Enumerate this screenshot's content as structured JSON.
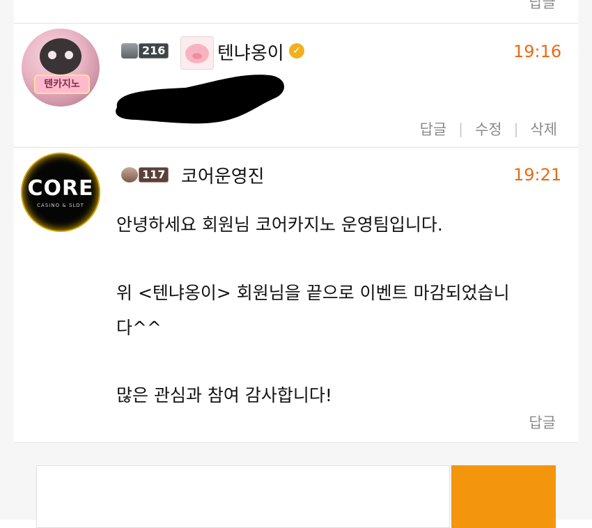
{
  "top": {
    "reply_label": "답글"
  },
  "comments": [
    {
      "level": "216",
      "nickname": "텐냐옹이",
      "time": "19:16",
      "avatar_sign": "텐카지노",
      "actions": {
        "reply": "답글",
        "edit": "수정",
        "delete": "삭제"
      }
    },
    {
      "level": "117",
      "nickname": "코어운영진",
      "time": "19:21",
      "avatar_logo": "CORE",
      "avatar_logo_sub": "CASINO & SLOT",
      "lines": [
        "안녕하세요 회원님 코어카지노 운영팀입니다.",
        "위 <텐냐옹이> 회원님을 끝으로 이벤트 마감되었습니",
        "다^^",
        "많은 관심과 참여 감사합니다!"
      ],
      "actions": {
        "reply": "답글"
      }
    }
  ],
  "colors": {
    "time": "#e86a13",
    "submit_button": "#f3950d",
    "verified": "#f2b01e"
  }
}
